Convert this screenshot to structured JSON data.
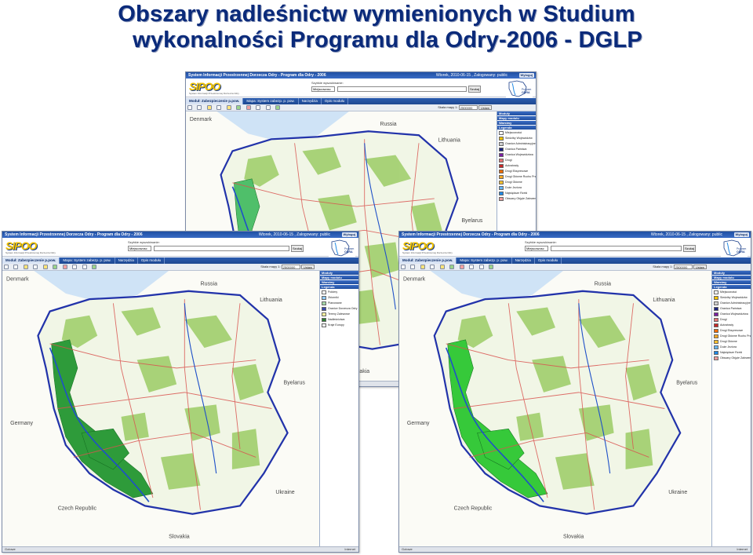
{
  "slide": {
    "title_line1": "Obszary nadleśnictw wymienionych w Studium",
    "title_line2": "wykonalności Programu dla Odry-2006 - DGLP"
  },
  "app": {
    "header_title": "System Informacji Przestrzennej Dorzecza Odry - Program dla Odry - 2006",
    "date_text": "Wtorek, 2010-06-15 , Zalogowany: public",
    "help_label": "Wyloguj",
    "logo_text": "SIPOO",
    "logo_subtitle": "System Informacji Przestrzennej Dorzecza Odry",
    "odra_logo_line1": "Program",
    "odra_logo_line2": "ODRA",
    "search_label": "Szybkie wyszukiwanie:",
    "search_select_value": "Miejscowosc",
    "search_button": "Szukaj",
    "tabs": [
      {
        "label": "Moduł: Zabezpieczenie p.pow."
      },
      {
        "label": "Mapa: System zabezp. p. pow."
      },
      {
        "label": "Narzędzia"
      },
      {
        "label": "Opis modułu"
      }
    ],
    "scale_label": "Skala mapy 1:",
    "scale_value": "2500000",
    "scale_button": "Ustaw",
    "status_left": "Gotowe",
    "status_right": "Internet",
    "panel_headers": [
      "Moduły",
      "Mapy modułu",
      "Warstwy",
      "Legenda"
    ],
    "legend_items": [
      {
        "label": "Miejscowości",
        "color": "#ffffff"
      },
      {
        "label": "Siedziby Województw",
        "color": "#f2c200"
      },
      {
        "label": "Granice Administracyjne",
        "color": "#cfcfcf"
      },
      {
        "label": "Granica Państwa",
        "color": "#1a237e"
      },
      {
        "label": "Granica Województwa",
        "color": "#7b1fa2"
      },
      {
        "label": "Drogi",
        "color": "#e57373"
      },
      {
        "label": "Autostrady",
        "color": "#c62828"
      },
      {
        "label": "Drogi Ekspresowe",
        "color": "#ef6c00"
      },
      {
        "label": "Drogi Główne Ruchu Przyspieszonego",
        "color": "#f9a825"
      },
      {
        "label": "Drogi Główne",
        "color": "#fbc02d"
      },
      {
        "label": "Duże Jeziora",
        "color": "#64b5f6"
      },
      {
        "label": "Największe Rzeki",
        "color": "#1e88e5"
      },
      {
        "label": "Obszary Objęte Zalewem",
        "color": "#ef9a9a"
      }
    ],
    "layers_items": [
      {
        "label": "Poldery",
        "color": "#ffffff"
      },
      {
        "label": "Zbiorniki",
        "color": "#90caf9"
      },
      {
        "label": "Planowane",
        "color": "#a5d6a7"
      },
      {
        "label": "Granice Dorzecza Odry",
        "color": "#3949ab"
      },
      {
        "label": "Tereny Zalewowe",
        "color": "#fff59d"
      },
      {
        "label": "Nadleśnictwa",
        "color": "#2e7d32"
      },
      {
        "label": "Kraje Europy",
        "color": "#f5f5f5"
      }
    ],
    "map_labels": {
      "denmark": "Denmark",
      "russia": "Russia",
      "lithuania": "Lithuania",
      "belarus": "Byelarus",
      "germany": "Germany",
      "czech": "Czech Republic",
      "ukraine": "Ukraine",
      "slovakia": "Slovakia"
    },
    "colors": {
      "poland_land": "#f3f7ea",
      "forest": "#8bc34a",
      "highlight_forest_districts": "#2e9b3a",
      "highlight_forest_districts_bright": "#36c93a",
      "border": "#2233aa",
      "roads": "#d9534f",
      "sea": "#cfe3f6"
    }
  }
}
